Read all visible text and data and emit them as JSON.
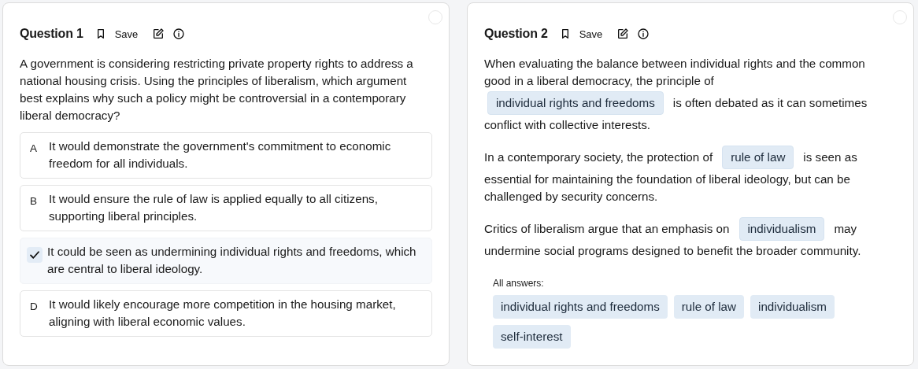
{
  "questions": [
    {
      "kind": "choice",
      "title": "Question 1",
      "save_label": "Save",
      "selected": false,
      "prompt": "A government is considering restricting private property rights to address a national housing crisis. Using the principles of liberalism, which argument best explains why such a policy might be controversial in a contemporary liberal democracy?",
      "options": [
        {
          "letter": "A",
          "text": "It would demonstrate the government's commitment to economic freedom for all individuals.",
          "selected": false
        },
        {
          "letter": "B",
          "text": "It would ensure the rule of law is applied equally to all citizens, supporting liberal principles.",
          "selected": false
        },
        {
          "text": "It could be seen as undermining individual rights and freedoms, which are central to liberal ideology.",
          "selected": true
        },
        {
          "letter": "D",
          "text": "It would likely encourage more competition in the housing market, aligning with liberal economic values.",
          "selected": false
        }
      ]
    },
    {
      "kind": "fill",
      "title": "Question 2",
      "save_label": "Save",
      "selected": false,
      "paragraphs": [
        [
          [
            {
              "kind": "text",
              "text": "When evaluating the balance between individual rights and the common"
            }
          ],
          [
            {
              "kind": "text",
              "text": "good in a liberal democracy, the principle of"
            }
          ],
          [
            {
              "kind": "blank",
              "text": "individual rights and freedoms"
            },
            {
              "kind": "text",
              "text": "is often debated as it can sometimes"
            }
          ],
          [
            {
              "kind": "text",
              "text": "conflict with collective interests."
            }
          ]
        ],
        [
          [
            {
              "kind": "text",
              "text": "In a contemporary society, the protection of"
            },
            {
              "kind": "blank",
              "text": "rule of law"
            },
            {
              "kind": "text",
              "text": "is seen as"
            }
          ],
          [
            {
              "kind": "text",
              "text": "essential for maintaining the foundation of liberal ideology, but can be"
            }
          ],
          [
            {
              "kind": "text",
              "text": "challenged by security concerns."
            }
          ]
        ],
        [
          [
            {
              "kind": "text",
              "text": "Critics of liberalism argue that an emphasis on"
            },
            {
              "kind": "blank",
              "text": "individualism"
            },
            {
              "kind": "text",
              "text": "may"
            }
          ],
          [
            {
              "kind": "text",
              "text": "undermine social programs designed to benefit the broader community."
            }
          ]
        ]
      ],
      "answers_label": "All answers:",
      "answers": [
        "individual rights and freedoms",
        "rule of law",
        "individualism",
        "self-interest"
      ]
    }
  ]
}
